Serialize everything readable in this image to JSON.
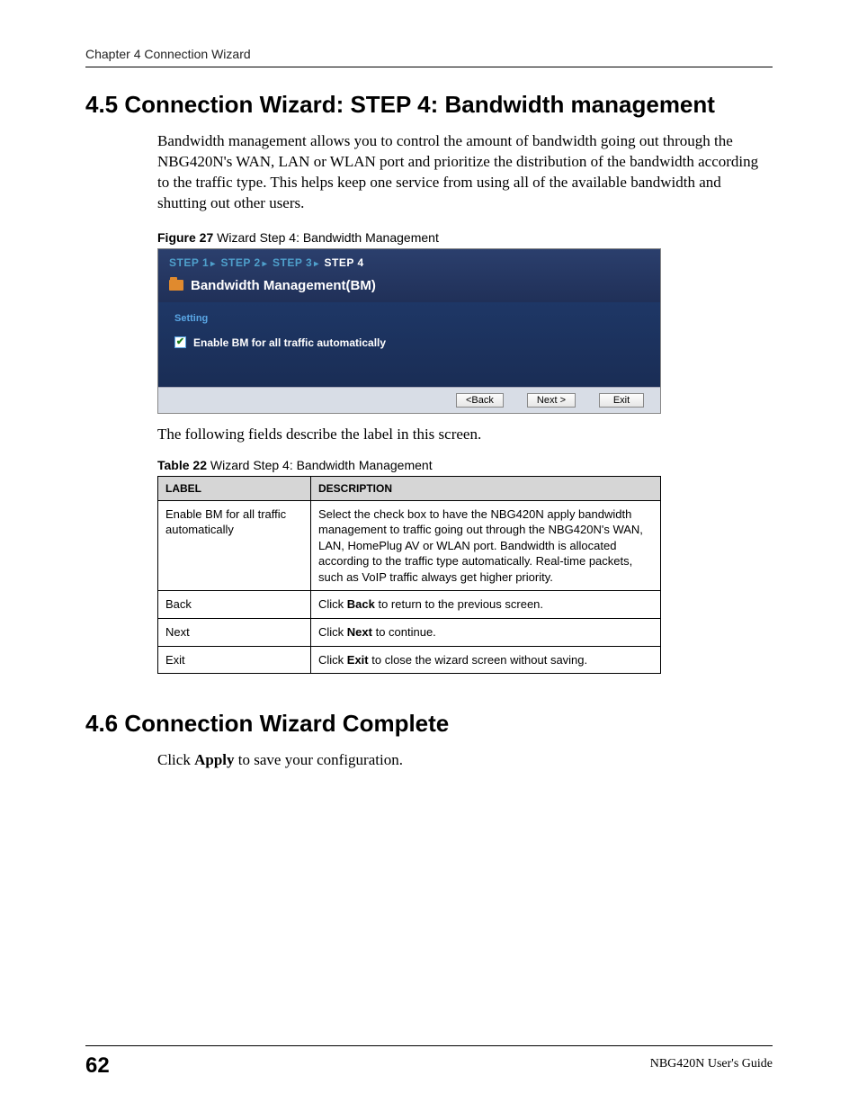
{
  "running_header": "Chapter 4 Connection Wizard",
  "section45": {
    "heading": "4.5  Connection Wizard: STEP 4: Bandwidth management",
    "body": "Bandwidth management allows you to control the amount of bandwidth going out through the NBG420N's WAN, LAN or WLAN port and prioritize the distribution of the bandwidth according to the traffic type. This helps keep one service from using all of the available bandwidth and shutting out other users."
  },
  "figure": {
    "label_prefix": "Figure 27",
    "label_rest": "   Wizard Step 4: Bandwidth Management",
    "steps": {
      "s1": "STEP 1",
      "s2": "STEP 2",
      "s3": "STEP 3",
      "s4": "STEP 4"
    },
    "title": "Bandwidth Management(BM)",
    "setting": "Setting",
    "checkbox_label": "Enable BM for all traffic automatically",
    "buttons": {
      "back": "<Back",
      "next": "Next >",
      "exit": "Exit"
    }
  },
  "between_figure_table": "The following fields describe the label in this screen.",
  "table": {
    "caption_prefix": "Table 22",
    "caption_rest": "   Wizard Step 4: Bandwidth Management",
    "headers": {
      "label": "LABEL",
      "desc": "DESCRIPTION"
    },
    "rows": [
      {
        "label": "Enable BM for all traffic automatically",
        "desc": "Select the check box to have the NBG420N apply bandwidth management to traffic going out through the NBG420N's WAN, LAN, HomePlug AV or WLAN port. Bandwidth is allocated according to the traffic type automatically. Real-time packets, such as VoIP traffic always get higher priority."
      },
      {
        "label": "Back",
        "bold": "Back",
        "desc_before": "Click ",
        "desc_after": " to return to the previous screen."
      },
      {
        "label": "Next",
        "bold": "Next",
        "desc_before": "Click ",
        "desc_after": " to continue."
      },
      {
        "label": "Exit",
        "bold": "Exit",
        "desc_before": "Click ",
        "desc_after": " to close the wizard screen without saving."
      }
    ]
  },
  "section46": {
    "heading": "4.6  Connection Wizard Complete",
    "body_before": "Click ",
    "body_bold": "Apply",
    "body_after": " to save your configuration."
  },
  "footer": {
    "page": "62",
    "guide": "NBG420N User's Guide"
  }
}
